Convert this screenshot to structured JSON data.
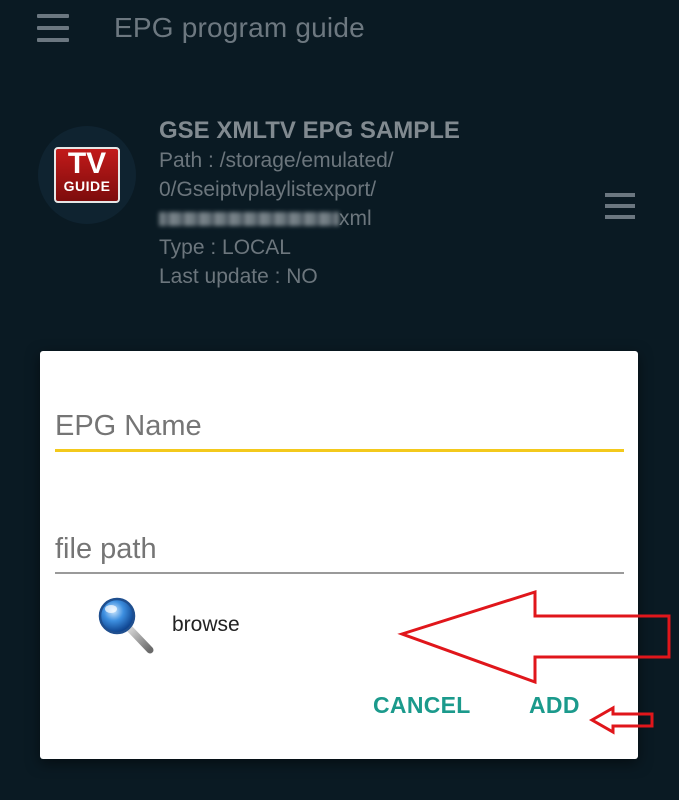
{
  "appbar": {
    "title": "EPG program guide",
    "menu_icon": "hamburger-menu-icon"
  },
  "epg": {
    "logo": {
      "line1": "TV",
      "line2": "GUIDE"
    },
    "name": "GSE XMLTV EPG SAMPLE",
    "path_line1": "Path : /storage/emulated/",
    "path_line2": "0/Gseiptvplaylistexport/",
    "path_line3_suffix": "xml",
    "type": "Type : LOCAL",
    "last_update": "Last update : NO",
    "more_icon": "hamburger-menu-icon"
  },
  "dialog": {
    "epg_name_placeholder": "EPG Name",
    "file_path_placeholder": "file path",
    "browse_label": "browse",
    "browse_icon": "magnifier-icon",
    "cancel_label": "CANCEL",
    "add_label": "ADD"
  },
  "colors": {
    "background": "#0a1a23",
    "accent": "#1b9a8c",
    "input_focus": "#f3c91c",
    "annotation": "#e0161b"
  }
}
